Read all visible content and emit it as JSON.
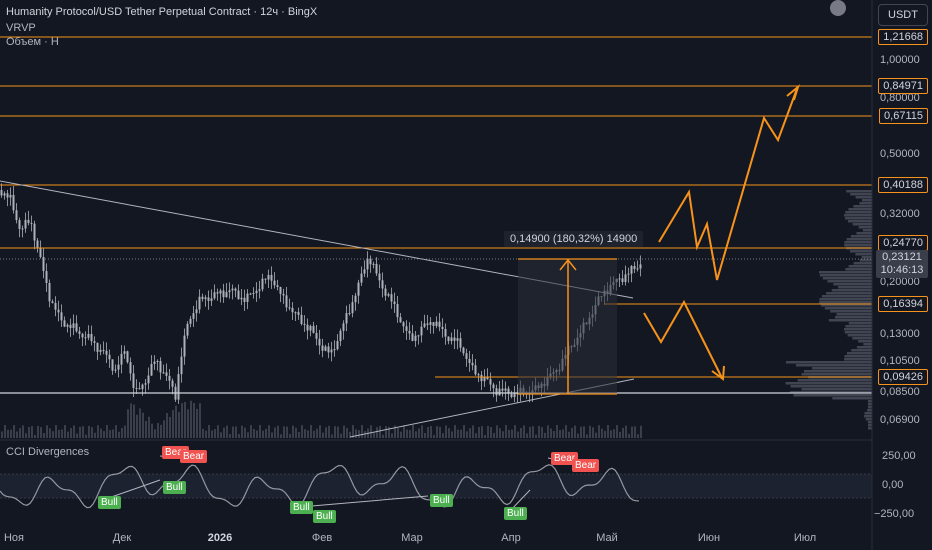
{
  "header": {
    "title": "Humanity Protocol/USD Tether Perpetual Contract · 12ч · BingX",
    "indicator1": "VRVP",
    "indicator2": "Объем · Н"
  },
  "toolbar": {
    "currency": "USDT"
  },
  "price_axis": {
    "labels": [
      "1,00000",
      "0,80000",
      "0,50000",
      "0,32000",
      "0,20000",
      "0,13000",
      "0,10500",
      "0,08500",
      "0,06900"
    ],
    "levels": [
      "1,21668",
      "0,84971",
      "0,67115",
      "0,40188",
      "0,24770",
      "0,16394",
      "0,09426"
    ],
    "current_price": "0,23121",
    "countdown": "10:46:13",
    "level_color": "#f7931a"
  },
  "time_axis": {
    "labels": [
      "Ноя",
      "Дек",
      "2026",
      "Фев",
      "Мар",
      "Апр",
      "Май",
      "Июн",
      "Июл"
    ]
  },
  "measure": {
    "label": "0,14900 (180,32%) 14900"
  },
  "cci": {
    "title": "CCI Divergences",
    "axis_labels": [
      "250,00",
      "0,00",
      "−250,00"
    ],
    "signals": [
      "Bear",
      "Bear",
      "Bull",
      "Bull",
      "Bull",
      "Bull",
      "Bull",
      "Bull",
      "Bear",
      "Bear"
    ],
    "bull_color": "#4caf50",
    "bear_color": "#f05350"
  }
}
